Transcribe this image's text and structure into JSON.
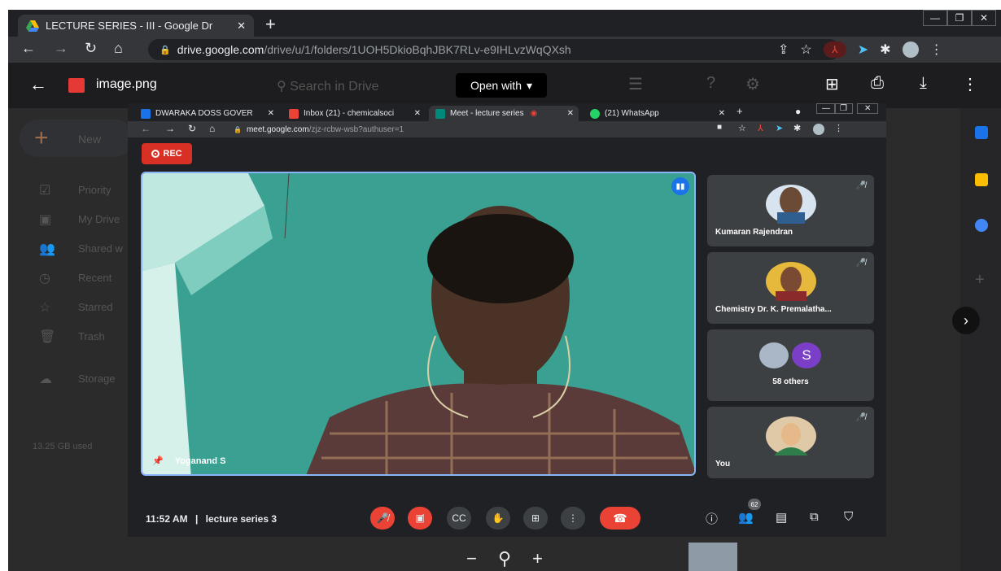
{
  "outer_browser": {
    "tab_title": "LECTURE SERIES - III - Google Dr",
    "new_tab_label": "+",
    "url_host": "drive.google.com",
    "url_path": "/drive/u/1/folders/1UOH5DkioBqhJBK7RLv-e9IHLvzWqQXsh"
  },
  "drive_preview": {
    "file_name": "image.png",
    "search_placeholder": "Search in Drive",
    "open_with_label": "Open with",
    "sidebar": {
      "new_label": "New",
      "items": [
        {
          "label": "Priority",
          "icon": "priority-icon"
        },
        {
          "label": "My Drive",
          "icon": "drive-icon"
        },
        {
          "label": "Shared w",
          "icon": "shared-icon"
        },
        {
          "label": "Recent",
          "icon": "clock-icon"
        },
        {
          "label": "Starred",
          "icon": "star-icon"
        },
        {
          "label": "Trash",
          "icon": "trash-icon"
        }
      ],
      "storage_label": "Storage",
      "storage_used": "13.25 GB used"
    }
  },
  "inner_browser": {
    "tabs": [
      {
        "label": "DWARAKA DOSS GOVER",
        "color": "#1a73e8"
      },
      {
        "label": "Inbox (21) - chemicalsoci",
        "color": "#ea4335"
      },
      {
        "label": "Meet - lecture series",
        "color": "#00897b"
      },
      {
        "label": "(21) WhatsApp",
        "color": "#25d366"
      }
    ],
    "url_host": "meet.google.com",
    "url_path": "/zjz-rcbw-wsb?authuser=1"
  },
  "meet": {
    "rec_label": "REC",
    "main_speaker": "Yoganand S",
    "participants": [
      {
        "name": "Kumaran Rajendran"
      },
      {
        "name": "Chemistry Dr. K. Premalatha..."
      },
      {
        "name": "58 others",
        "initial": "S"
      },
      {
        "name": "You"
      }
    ],
    "time": "11:52 AM",
    "separator": "|",
    "meeting_name": "lecture series 3",
    "people_count": "62"
  }
}
